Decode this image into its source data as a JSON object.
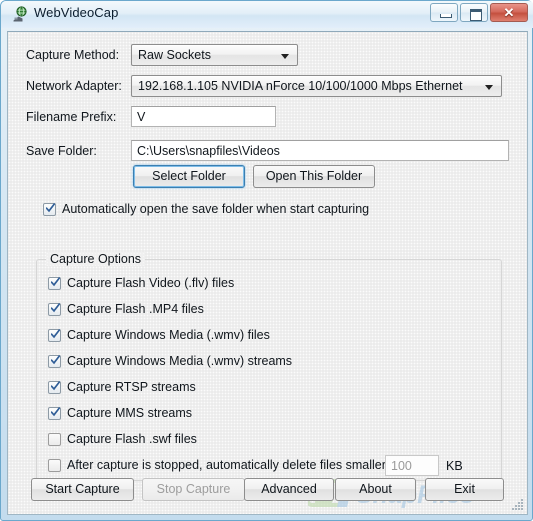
{
  "window": {
    "title": "WebVideoCap",
    "icon": "webcam-globe-icon",
    "controls": {
      "minimize_label": "–",
      "maximize_label": "□",
      "close_label": "✕"
    }
  },
  "form": {
    "capture_method": {
      "label": "Capture Method:",
      "value": "Raw Sockets"
    },
    "network_adapter": {
      "label": "Network Adapter:",
      "value": "192.168.1.105   NVIDIA nForce 10/100/1000 Mbps Ethernet"
    },
    "filename_prefix": {
      "label": "Filename Prefix:",
      "value": "V"
    },
    "save_folder": {
      "label": "Save Folder:",
      "value": "C:\\Users\\snapfiles\\Videos"
    },
    "select_folder_button": "Select Folder",
    "open_folder_button": "Open This Folder",
    "auto_open": {
      "label": "Automatically open the save folder when start capturing",
      "checked": true
    }
  },
  "capture_options": {
    "legend": "Capture Options",
    "items": [
      {
        "label": "Capture Flash Video (.flv) files",
        "checked": true
      },
      {
        "label": "Capture Flash .MP4 files",
        "checked": true
      },
      {
        "label": "Capture Windows Media (.wmv) files",
        "checked": true
      },
      {
        "label": "Capture Windows Media (.wmv) streams",
        "checked": true
      },
      {
        "label": "Capture RTSP streams",
        "checked": true
      },
      {
        "label": "Capture MMS streams",
        "checked": true
      },
      {
        "label": "Capture Flash .swf files",
        "checked": false
      }
    ],
    "delete_small": {
      "label": "After capture is stopped, automatically delete files smaller than:",
      "checked": false,
      "size_value": "100",
      "unit_label": "KB"
    }
  },
  "footer": {
    "buttons": [
      {
        "label": "Start Capture",
        "enabled": true
      },
      {
        "label": "Stop Capture",
        "enabled": false
      },
      {
        "label": "Advanced",
        "enabled": true
      },
      {
        "label": "About",
        "enabled": true
      },
      {
        "label": "Exit",
        "enabled": true
      }
    ]
  },
  "watermark": {
    "text": "SnapFiles"
  },
  "colors": {
    "accent": "#3c7fb1",
    "close_button": "#c4503f",
    "checkmark": "#2f5d97",
    "watermark_blue": "#9cc2e0",
    "watermark_green": "#bcd9a8"
  }
}
